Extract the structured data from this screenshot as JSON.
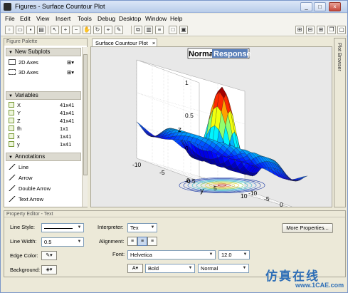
{
  "window": {
    "title": "Figures - Surface Countour Plot",
    "buttons": [
      "_",
      "□",
      "×"
    ]
  },
  "menu": [
    "File",
    "Edit",
    "View",
    "Insert",
    "Tools",
    "Debug",
    "Desktop",
    "Window",
    "Help"
  ],
  "palette": {
    "title": "Figure Palette",
    "subplots_header": "New Subplots",
    "subplots": [
      "2D Axes",
      "3D Axes"
    ],
    "variables_header": "Variables",
    "variables": [
      {
        "name": "X",
        "size": "41x41"
      },
      {
        "name": "Y",
        "size": "41x41"
      },
      {
        "name": "Z",
        "size": "41x41"
      },
      {
        "name": "fh",
        "size": "1x1"
      },
      {
        "name": "x",
        "size": "1x41"
      },
      {
        "name": "y",
        "size": "1x41"
      }
    ],
    "annotations_header": "Annotations",
    "annotations": [
      "Line",
      "Arrow",
      "Double Arrow",
      "Text Arrow"
    ]
  },
  "figure": {
    "tab_label": "Surface Countour Plot",
    "tab_close": "×",
    "plot_browser": "Plot Browser",
    "title_normal": "Normal",
    "title_selected": "Response"
  },
  "chart_data": {
    "type": "surface",
    "title": "Normal Response",
    "xlabel": "x",
    "ylabel": "y",
    "zlabel": "z",
    "x_ticks": [
      "-10",
      "-5",
      "0",
      "5",
      "10"
    ],
    "y_ticks": [
      "-10",
      "-5",
      "0",
      "5",
      "10"
    ],
    "z_ticks": [
      "-0.5",
      "0",
      "0.5",
      "1"
    ],
    "xlim": [
      -10,
      10
    ],
    "ylim": [
      -10,
      10
    ],
    "zlim": [
      -0.5,
      1
    ],
    "colormap": "jet",
    "contour_below": true
  },
  "property_editor": {
    "title": "Property Editor - Text",
    "line_style_label": "Line Style:",
    "line_width_label": "Line Width:",
    "line_width_value": "0.5",
    "edge_color_label": "Edge Color:",
    "background_label": "Background:",
    "interpreter_label": "Interpreter:",
    "interpreter_value": "Tex",
    "alignment_label": "Alignment:",
    "font_label": "Font:",
    "font_value": "Helvetica",
    "font_size_value": "12.0",
    "weight_value": "Bold",
    "angle_value": "Normal",
    "more_properties": "More Properties..."
  },
  "watermark": {
    "cn": "仿真在线",
    "url": "www.1CAE.com"
  }
}
